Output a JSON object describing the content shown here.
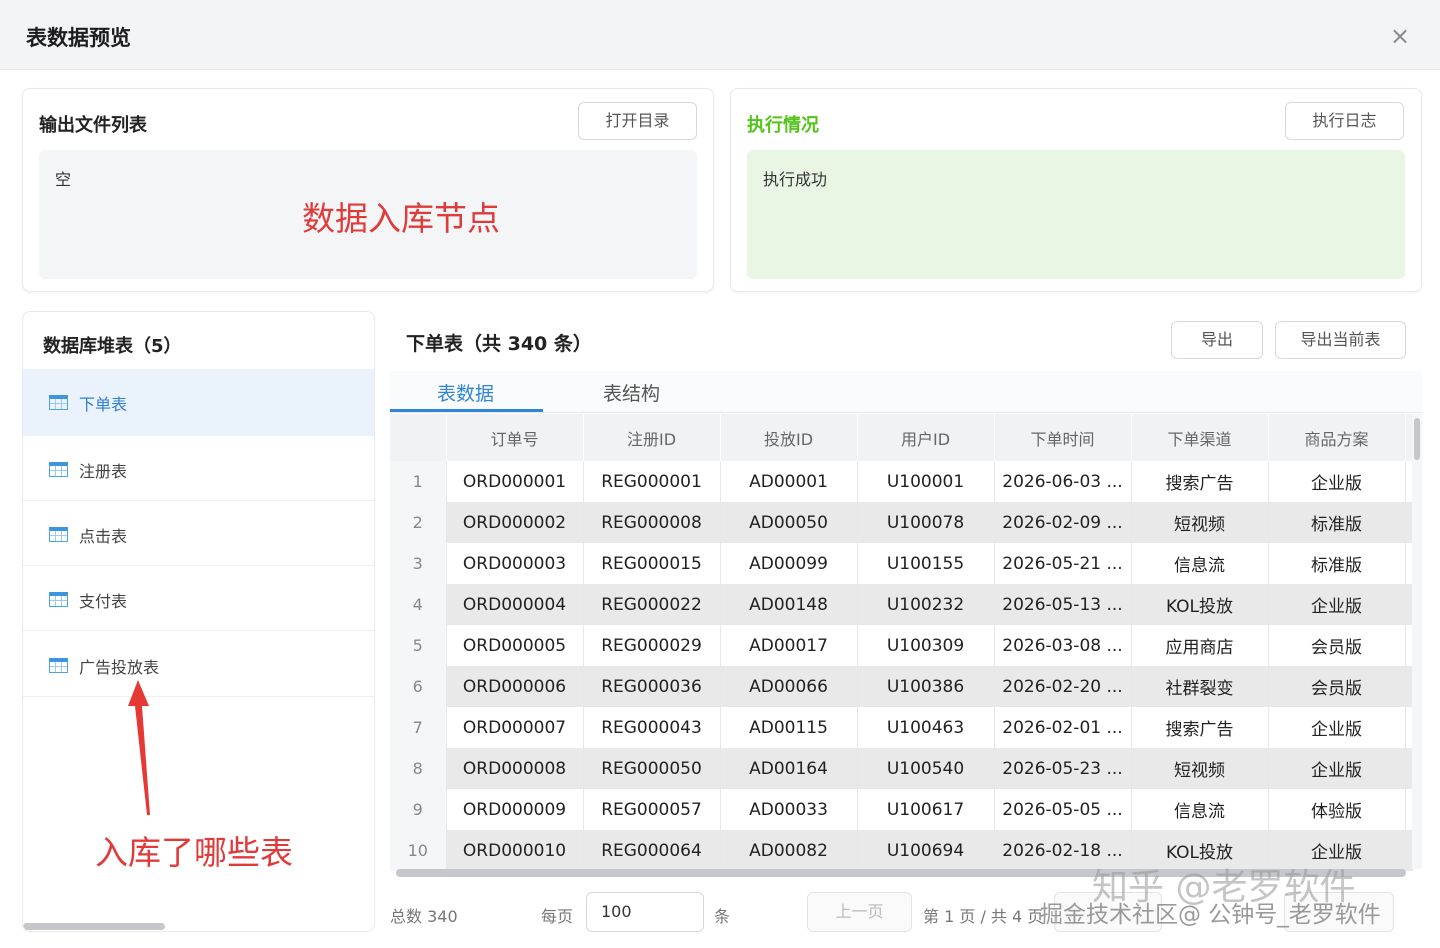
{
  "dialog": {
    "title": "表数据预览",
    "close_icon": "×"
  },
  "output_card": {
    "title": "输出文件列表",
    "button": "打开目录",
    "content": "空",
    "annotation": "数据入库节点"
  },
  "exec_card": {
    "title": "执行情况",
    "button": "执行日志",
    "content": "执行成功",
    "title_color": "#52c41a"
  },
  "sidebar": {
    "title": "数据库堆表（5）",
    "items": [
      {
        "label": "下单表"
      },
      {
        "label": "注册表"
      },
      {
        "label": "点击表"
      },
      {
        "label": "支付表"
      },
      {
        "label": "广告投放表"
      }
    ],
    "annotation": "入库了哪些表"
  },
  "main": {
    "title": "下单表（共 340 条）",
    "export_button": "导出",
    "export_current_button": "导出当前表",
    "tabs": [
      {
        "label": "表数据"
      },
      {
        "label": "表结构"
      }
    ],
    "columns": [
      "订单号",
      "注册ID",
      "投放ID",
      "用户ID",
      "下单时间",
      "下单渠道",
      "商品方案"
    ],
    "rows": [
      {
        "n": "1",
        "cells": [
          "ORD000001",
          "REG000001",
          "AD00001",
          "U100001",
          "2026-06-03 ...",
          "搜索广告",
          "企业版"
        ]
      },
      {
        "n": "2",
        "cells": [
          "ORD000002",
          "REG000008",
          "AD00050",
          "U100078",
          "2026-02-09 ...",
          "短视频",
          "标准版"
        ]
      },
      {
        "n": "3",
        "cells": [
          "ORD000003",
          "REG000015",
          "AD00099",
          "U100155",
          "2026-05-21 ...",
          "信息流",
          "标准版"
        ]
      },
      {
        "n": "4",
        "cells": [
          "ORD000004",
          "REG000022",
          "AD00148",
          "U100232",
          "2026-05-13 ...",
          "KOL投放",
          "企业版"
        ]
      },
      {
        "n": "5",
        "cells": [
          "ORD000005",
          "REG000029",
          "AD00017",
          "U100309",
          "2026-03-08 ...",
          "应用商店",
          "会员版"
        ]
      },
      {
        "n": "6",
        "cells": [
          "ORD000006",
          "REG000036",
          "AD00066",
          "U100386",
          "2026-02-20 ...",
          "社群裂变",
          "会员版"
        ]
      },
      {
        "n": "7",
        "cells": [
          "ORD000007",
          "REG000043",
          "AD00115",
          "U100463",
          "2026-02-01 ...",
          "搜索广告",
          "企业版"
        ]
      },
      {
        "n": "8",
        "cells": [
          "ORD000008",
          "REG000050",
          "AD00164",
          "U100540",
          "2026-05-23 ...",
          "短视频",
          "企业版"
        ]
      },
      {
        "n": "9",
        "cells": [
          "ORD000009",
          "REG000057",
          "AD00033",
          "U100617",
          "2026-05-05 ...",
          "信息流",
          "体验版"
        ]
      },
      {
        "n": "10",
        "cells": [
          "ORD000010",
          "REG000064",
          "AD00082",
          "U100694",
          "2026-02-18 ...",
          "KOL投放",
          "企业版"
        ]
      }
    ]
  },
  "pager": {
    "total": "总数 340",
    "per_page_label": "每页",
    "per_page_value": "100",
    "unit": "条",
    "prev": "上一页",
    "page_info": "第 1 页 / 共 4 页"
  },
  "watermarks": {
    "zhihu": "知乎 @老罗软件",
    "juejin": "掘金技术社区@ 公钟号_老罗软件"
  }
}
